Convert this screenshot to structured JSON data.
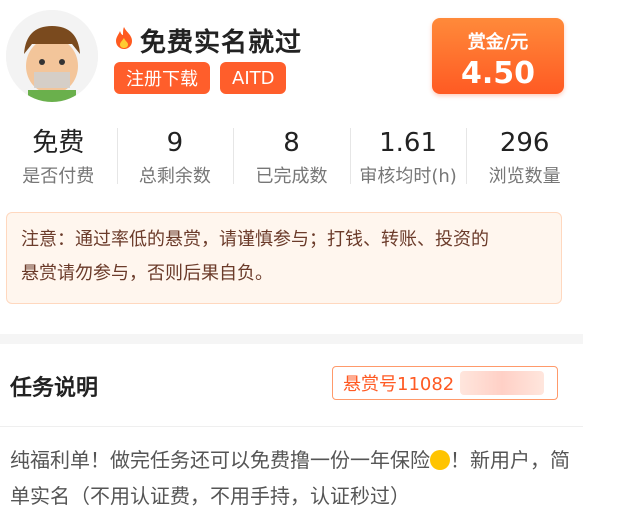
{
  "header": {
    "title": "免费实名就过",
    "tags": [
      "注册下载",
      "AITD"
    ],
    "reward_label": "赏金/元",
    "reward_value": "4.50"
  },
  "stats": [
    {
      "value": "免费",
      "label": "是否付费"
    },
    {
      "value": "9",
      "label": "总剩余数"
    },
    {
      "value": "8",
      "label": "已完成数"
    },
    {
      "value": "1.61",
      "label": "审核均时(h)"
    },
    {
      "value": "296",
      "label": "浏览数量"
    }
  ],
  "notice": {
    "text_line1": "注意：通过率低的悬赏，请谨慎参与；打钱、转账、投资的",
    "text_line2": "悬赏请勿参与，否则后果自负。"
  },
  "task": {
    "section_title": "任务说明",
    "id_label": "悬赏号11082",
    "desc_part1": "纯福利单！做完任务还可以免费撸一份一年保险",
    "desc_part2": "！新用户，简单实名（不用认证费，不用手持，认证秒过）"
  },
  "colors": {
    "accent": "#ff5e2b",
    "notice_bg": "#fff6ee"
  }
}
